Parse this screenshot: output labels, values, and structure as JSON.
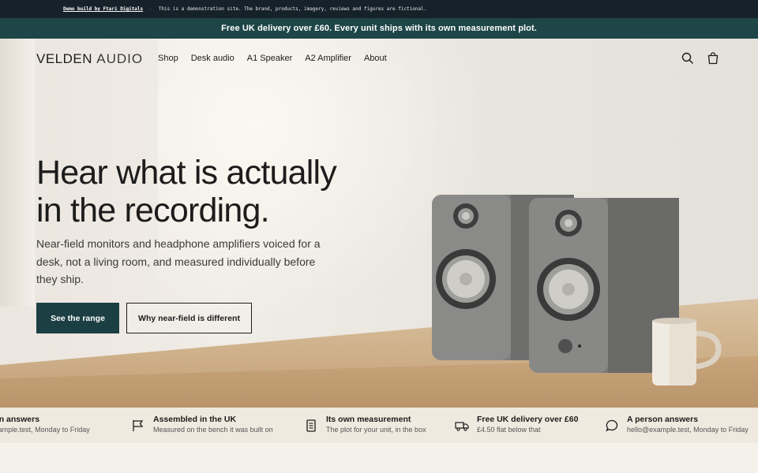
{
  "demo_strip": {
    "link": "Demo build by Ftari Digitals",
    "notice": "This is a demonstration site. The brand, products, imagery, reviews and figures are fictional."
  },
  "announcement": "Free UK delivery over £60. Every unit ships with its own measurement plot.",
  "header": {
    "brand_part1": "VELDEN",
    "brand_part2": "AUDIO",
    "nav": [
      "Shop",
      "Desk audio",
      "A1 Speaker",
      "A2 Amplifier",
      "About"
    ],
    "icons": [
      "search-icon",
      "cart-icon"
    ]
  },
  "hero": {
    "headline_line1": "Hear what is actually",
    "headline_line2": "in the recording.",
    "subcopy": "Near-field monitors and headphone amplifiers voiced for a desk, not a living room, and measured individually before they ship.",
    "primary_cta": "See the range",
    "secondary_cta": "Why near-field is different"
  },
  "features": [
    {
      "icon": "chat-icon",
      "title": "A person answers",
      "subtitle": "hello@example.test, Monday to Friday"
    },
    {
      "icon": "flag-icon",
      "title": "Assembled in the UK",
      "subtitle": "Measured on the bench it was built on"
    },
    {
      "icon": "document-icon",
      "title": "Its own measurement",
      "subtitle": "The plot for your unit, in the box"
    },
    {
      "icon": "truck-icon",
      "title": "Free UK delivery over £60",
      "subtitle": "£4.50 flat below that"
    },
    {
      "icon": "chat-icon",
      "title": "A person answers",
      "subtitle": "hello@example.test, Monday to Friday"
    }
  ],
  "colors": {
    "announcement_bg": "#1e4547",
    "demo_bg": "#16222a",
    "primary_button": "#1c3f44",
    "features_bg": "#efe9df"
  }
}
